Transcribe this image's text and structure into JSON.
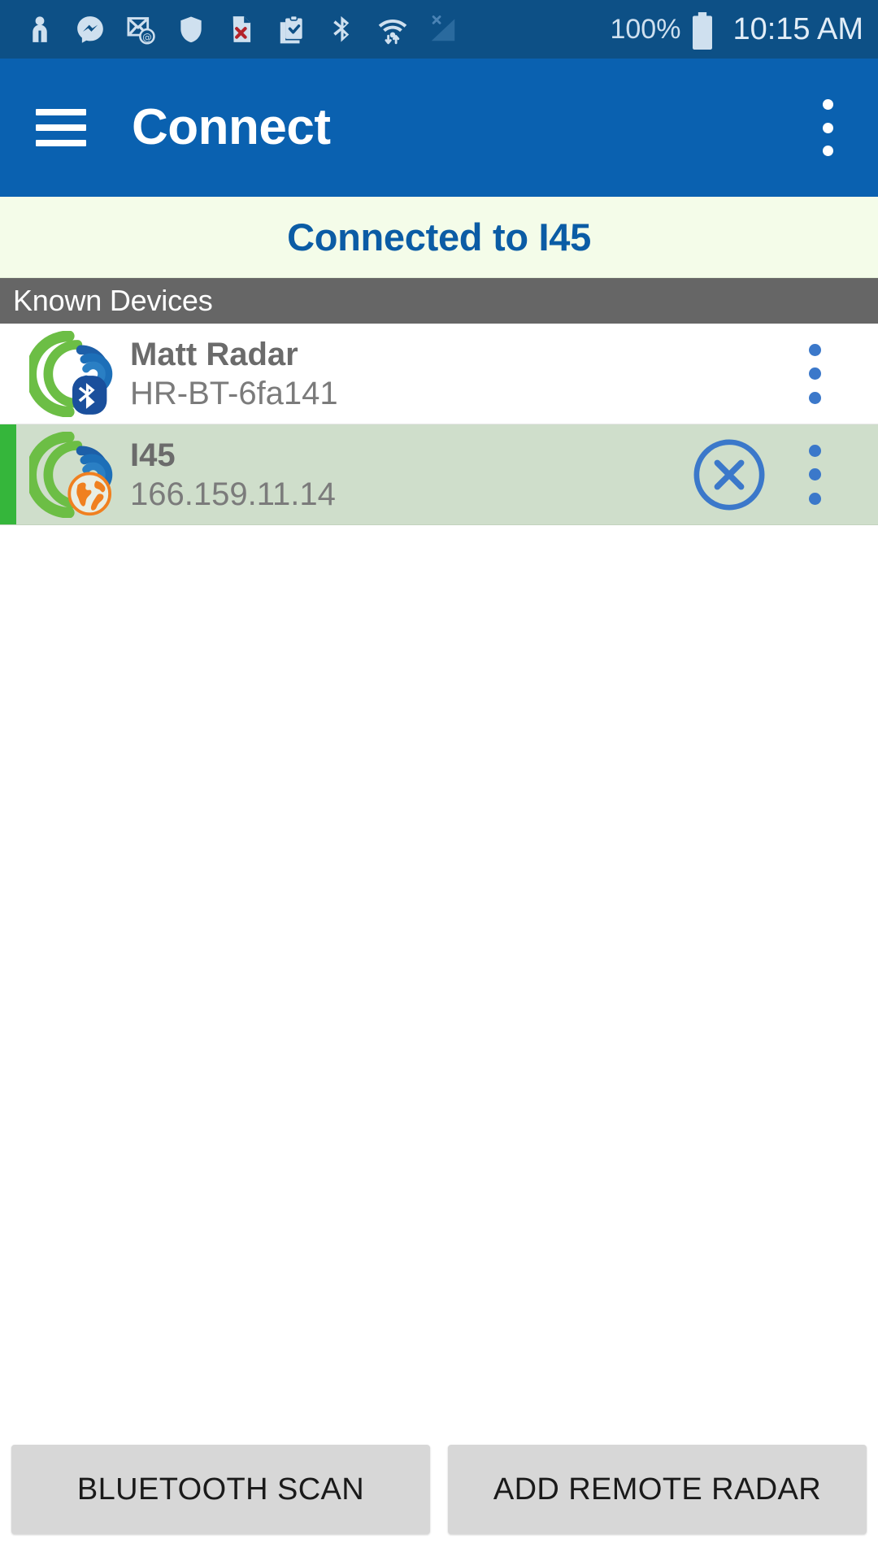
{
  "status_bar": {
    "icons": [
      {
        "name": "person-icon"
      },
      {
        "name": "messenger-icon"
      },
      {
        "name": "email-at-icon"
      },
      {
        "name": "shield-icon"
      },
      {
        "name": "document-error-icon"
      },
      {
        "name": "clipboard-check-icon"
      },
      {
        "name": "bluetooth-icon"
      },
      {
        "name": "wifi-transfer-icon"
      },
      {
        "name": "cellular-no-signal-icon"
      }
    ],
    "battery_percent": "100%",
    "battery_icon": "battery-full-icon",
    "time": "10:15 AM"
  },
  "appbar": {
    "menu_icon": "hamburger-menu-icon",
    "title": "Connect",
    "overflow_icon": "more-vertical-icon"
  },
  "banner": {
    "text": "Connected to I45",
    "background_color": "#f4fce9",
    "text_color": "#0b5ca5"
  },
  "section": {
    "title": "Known Devices",
    "background_color": "#666666"
  },
  "devices": [
    {
      "name": "Matt Radar",
      "sub": "HR-BT-6fa141",
      "badge": "bluetooth-badge-icon",
      "selected": false,
      "has_disconnect": false,
      "overflow_icon": "more-vertical-icon"
    },
    {
      "name": "I45",
      "sub": "166.159.11.14",
      "badge": "globe-badge-icon",
      "selected": true,
      "has_disconnect": true,
      "disconnect_icon": "close-circle-icon",
      "overflow_icon": "more-vertical-icon"
    }
  ],
  "bottom_buttons": [
    {
      "label": "BLUETOOTH SCAN",
      "name": "bluetooth-scan-button"
    },
    {
      "label": "ADD REMOTE RADAR",
      "name": "add-remote-radar-button"
    }
  ],
  "colors": {
    "status_bar": "#0d5086",
    "app_bar": "#0a61b0",
    "accent_blue": "#3b78ca",
    "selected_row": "#cfdecb",
    "selected_edge": "#35b63b",
    "button_gray": "#d7d7d7"
  }
}
